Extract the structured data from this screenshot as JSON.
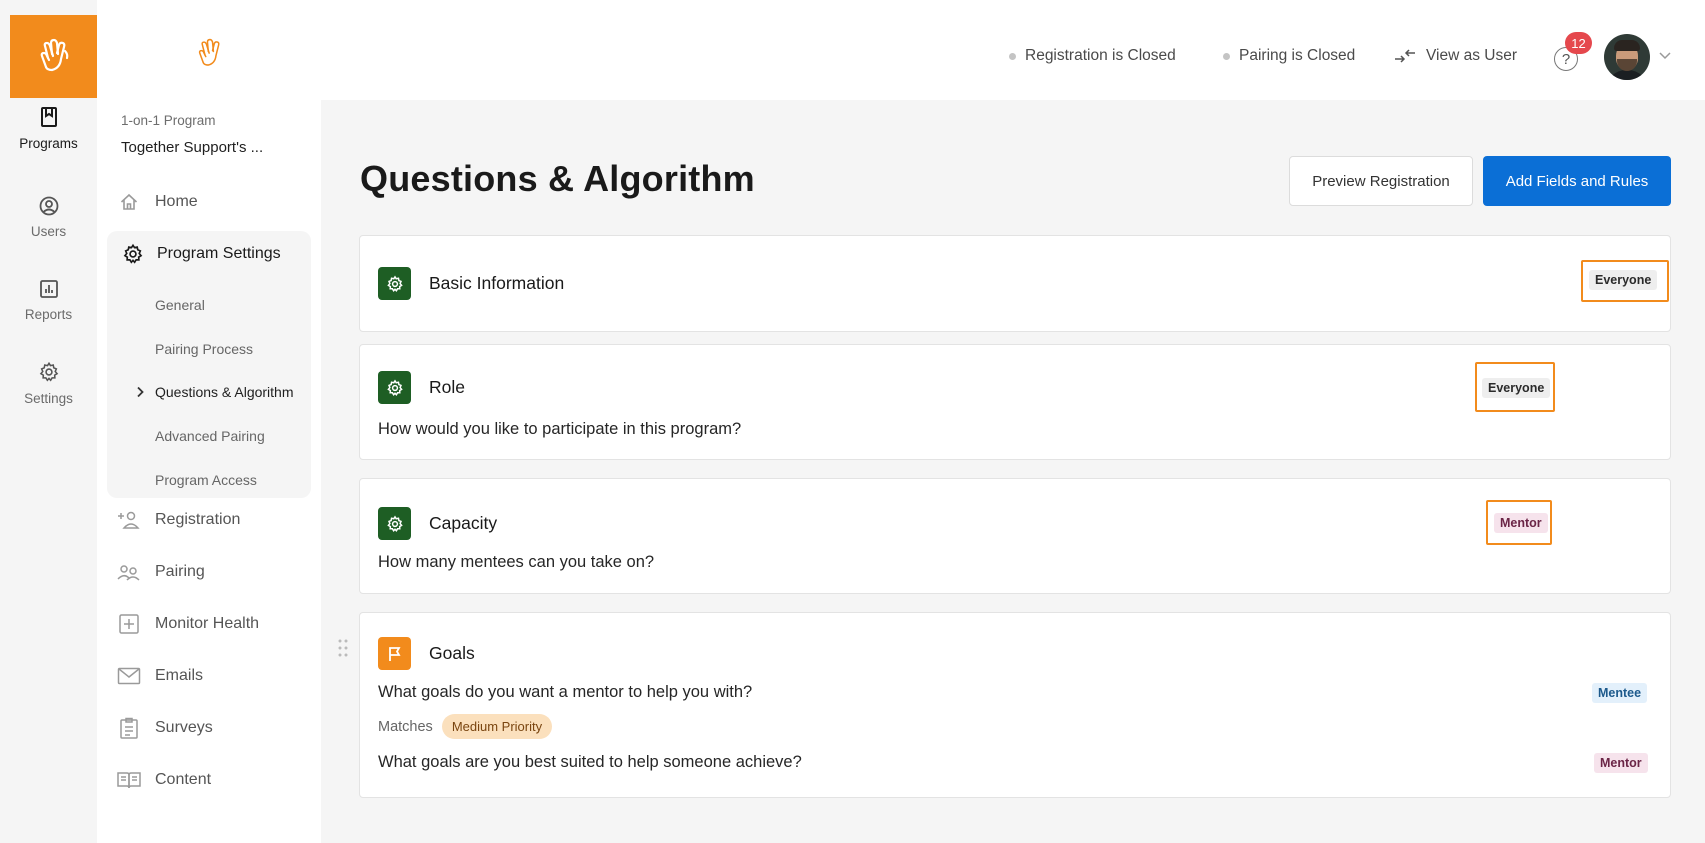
{
  "rail": {
    "items": [
      {
        "label": "Programs",
        "icon": "programs-book-icon"
      },
      {
        "label": "Users",
        "icon": "user-circle-icon"
      },
      {
        "label": "Reports",
        "icon": "reports-chart-icon"
      },
      {
        "label": "Settings",
        "icon": "settings-gear-icon"
      }
    ]
  },
  "sidebar": {
    "program_type": "1-on-1 Program",
    "program_name": "Together Support's ...",
    "home_label": "Home",
    "program_settings_label": "Program Settings",
    "settings_items": [
      {
        "label": "General"
      },
      {
        "label": "Pairing Process"
      },
      {
        "label": "Questions & Algorithm",
        "current": true
      },
      {
        "label": "Advanced Pairing"
      },
      {
        "label": "Program Access"
      }
    ],
    "items": [
      {
        "label": "Registration",
        "icon": "add-person-icon"
      },
      {
        "label": "Pairing",
        "icon": "pairing-people-icon"
      },
      {
        "label": "Monitor Health",
        "icon": "health-plus-icon"
      },
      {
        "label": "Emails",
        "icon": "mail-icon"
      },
      {
        "label": "Surveys",
        "icon": "survey-clipboard-icon"
      },
      {
        "label": "Content",
        "icon": "content-book-icon"
      }
    ]
  },
  "topbar": {
    "registration_status": "Registration is Closed",
    "pairing_status": "Pairing is Closed",
    "view_as_user": "View as User",
    "notification_count": "12"
  },
  "main": {
    "title": "Questions & Algorithm",
    "preview_button": "Preview Registration",
    "add_button": "Add Fields and Rules",
    "cards": [
      {
        "title": "Basic Information",
        "audience": "Everyone",
        "icon": "gear-icon"
      },
      {
        "title": "Role",
        "question": "How would you like to participate in this program?",
        "audience": "Everyone",
        "icon": "gear-icon"
      },
      {
        "title": "Capacity",
        "question": "How many mentees can you take on?",
        "audience": "Mentor",
        "icon": "gear-icon"
      },
      {
        "title": "Goals",
        "icon": "flag-icon",
        "question_mentee": "What goals do you want a mentor to help you with?",
        "audience_mentee": "Mentee",
        "matches_label": "Matches",
        "priority": "Medium Priority",
        "question_mentor": "What goals are you best suited to help someone achieve?",
        "audience_mentor": "Mentor"
      }
    ]
  },
  "colors": {
    "brand_orange": "#f28b1c",
    "primary_blue": "#0b6fd6",
    "gear_green": "#1e5e24",
    "highlight_orange": "#f28b1c"
  }
}
